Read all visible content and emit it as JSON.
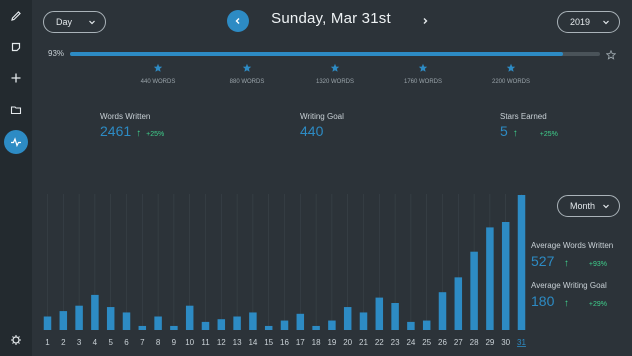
{
  "sidebar": {
    "items": [
      {
        "icon": "pencil-icon"
      },
      {
        "icon": "note-icon"
      },
      {
        "icon": "plus-icon"
      },
      {
        "icon": "folder-icon"
      },
      {
        "icon": "activity-icon",
        "active": true
      },
      {
        "icon": "gear-icon"
      }
    ]
  },
  "header": {
    "period_select": "Day",
    "date_title": "Sunday, Mar 31st",
    "year_select": "2019"
  },
  "progress": {
    "percent_label": "93%",
    "fraction": 0.93,
    "milestones": [
      "440 WORDS",
      "880 WORDS",
      "1320 WORDS",
      "1760 WORDS",
      "2200 WORDS"
    ]
  },
  "stats": [
    {
      "label": "Words Written",
      "value": "2461",
      "change": "+25%"
    },
    {
      "label": "Writing Goal",
      "value": "440"
    },
    {
      "label": "Stars Earned",
      "value": "5",
      "change": "+25%"
    }
  ],
  "chart_data": {
    "type": "bar",
    "categories": [
      "1",
      "2",
      "3",
      "4",
      "5",
      "6",
      "7",
      "8",
      "9",
      "10",
      "11",
      "12",
      "13",
      "14",
      "15",
      "16",
      "17",
      "18",
      "19",
      "20",
      "21",
      "22",
      "23",
      "24",
      "25",
      "26",
      "27",
      "28",
      "29",
      "30",
      "31"
    ],
    "values": [
      10,
      14,
      18,
      26,
      17,
      13,
      3,
      10,
      3,
      18,
      6,
      8,
      10,
      13,
      3,
      7,
      12,
      3,
      7,
      17,
      13,
      24,
      20,
      6,
      7,
      28,
      39,
      58,
      76,
      80,
      100
    ],
    "selected": "31",
    "color": "#2d8bc4"
  },
  "right_panel": {
    "range_select": "Month",
    "avg_words": {
      "label": "Average Words Written",
      "value": "527",
      "change": "+93%"
    },
    "avg_goal": {
      "label": "Average Writing Goal",
      "value": "180",
      "change": "+29%"
    }
  }
}
